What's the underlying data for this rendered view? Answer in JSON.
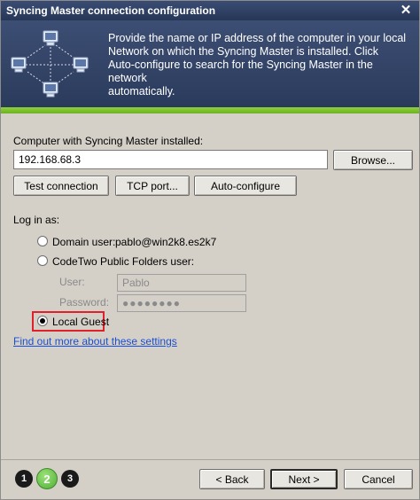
{
  "window": {
    "title": "Syncing Master connection configuration",
    "close_glyph": "✕"
  },
  "banner": {
    "text": "Provide the name or IP address of the computer in your local\nNetwork on which the Syncing Master is installed. Click\nAuto-configure to search for the Syncing Master in the network\nautomatically.",
    "graphic_icon": "network-computers-icon"
  },
  "computer": {
    "label": "Computer with Syncing Master installed:",
    "value": "192.168.68.3",
    "browse_label": "Browse..."
  },
  "actions": {
    "test_label": "Test connection",
    "tcp_label": "TCP port...",
    "auto_label": "Auto-configure"
  },
  "login": {
    "heading": "Log in as:",
    "domain_user_label": "Domain user:",
    "domain_user_value": "pablo@win2k8.es2k7",
    "public_folders_label": "CodeTwo Public Folders user:",
    "user_label": "User:",
    "user_value": "Pablo",
    "password_label": "Password:",
    "password_value": "●●●●●●●●",
    "local_guest_label": "Local Guest",
    "selected": "local_guest"
  },
  "help_link": "Find out more about these settings",
  "footer": {
    "steps": [
      "1",
      "2",
      "3"
    ],
    "current_step": "2",
    "back_label": "< Back",
    "next_label": "Next >",
    "cancel_label": "Cancel"
  },
  "colors": {
    "title_bg": "#2f4066",
    "accent_green": "#7cc22e",
    "highlight_red": "#e0202a",
    "link": "#1a4fd1"
  }
}
